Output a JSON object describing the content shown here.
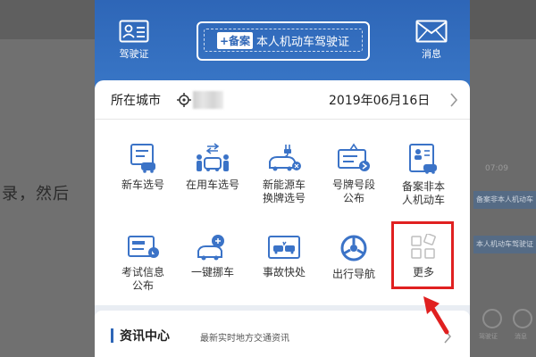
{
  "background": {
    "left_text": "录，然后",
    "right_time": "07:09",
    "right_rows": [
      "备案非本人机动车",
      "本人机动车驾驶证"
    ],
    "right_icons": [
      "驾驶证",
      "消息"
    ]
  },
  "header": {
    "license_label": "驾驶证",
    "banner_badge": "+备案",
    "banner_text": "本人机动车驾驶证",
    "message_label": "消息"
  },
  "city": {
    "label": "所在城市",
    "date": "2019年06月16日"
  },
  "services": [
    {
      "label": "新车选号",
      "icon": "new-car-plate-icon"
    },
    {
      "label": "在用车选号",
      "icon": "used-car-plate-icon"
    },
    {
      "label": "新能源车换牌选号",
      "icon": "new-energy-car-icon"
    },
    {
      "label": "号牌号段公布",
      "icon": "plate-range-icon"
    },
    {
      "label": "备案非本人机动车",
      "icon": "register-vehicle-icon"
    },
    {
      "label": "考试信息公布",
      "icon": "exam-info-icon"
    },
    {
      "label": "一键挪车",
      "icon": "move-car-icon"
    },
    {
      "label": "事故快处",
      "icon": "accident-icon"
    },
    {
      "label": "出行导航",
      "icon": "navigation-icon"
    },
    {
      "label": "更多",
      "icon": "more-grid-icon"
    }
  ],
  "news": {
    "title": "资讯中心",
    "subtitle": "最新实时地方交通资讯"
  },
  "colors": {
    "primary": "#2e66b7",
    "icon_blue": "#3b73c7",
    "highlight": "#e02020"
  }
}
